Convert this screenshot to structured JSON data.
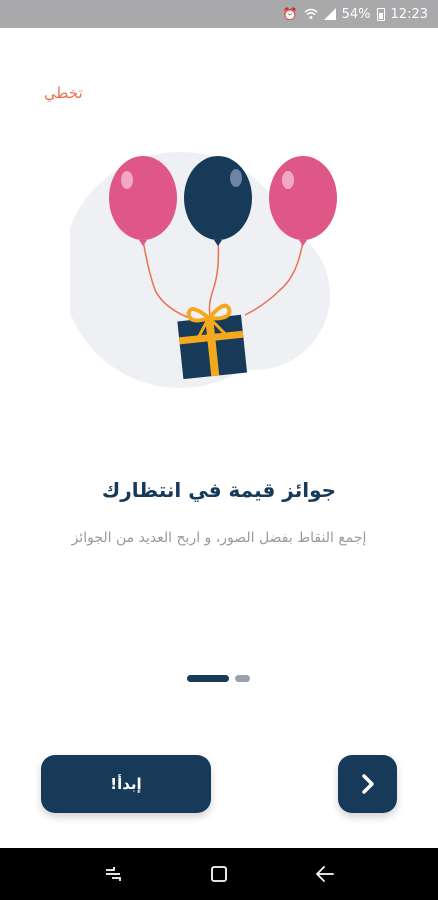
{
  "status_bar": {
    "battery": "54%",
    "time": "12:23",
    "icons": [
      "alarm-icon",
      "wifi-icon",
      "signal-icon",
      "battery-icon"
    ]
  },
  "skip_label": "تخطي",
  "onboarding": {
    "title": "جوائز قيمة في انتظارك",
    "subtitle": "إجمع النقاط بفضل الصور، و اربح العديد من الجوائز",
    "page_index": 1,
    "page_count": 2
  },
  "buttons": {
    "start_label": "إبدأ!",
    "next_icon": "chevron-right-icon"
  },
  "nav_bar": {
    "icons": [
      "recent-apps-icon",
      "home-icon",
      "back-icon"
    ]
  },
  "colors": {
    "primary": "#173a58",
    "accent": "#e8744f",
    "balloon_pink": "#df5787",
    "gift_ribbon": "#f4a81d",
    "backdrop": "#eef0f3"
  }
}
